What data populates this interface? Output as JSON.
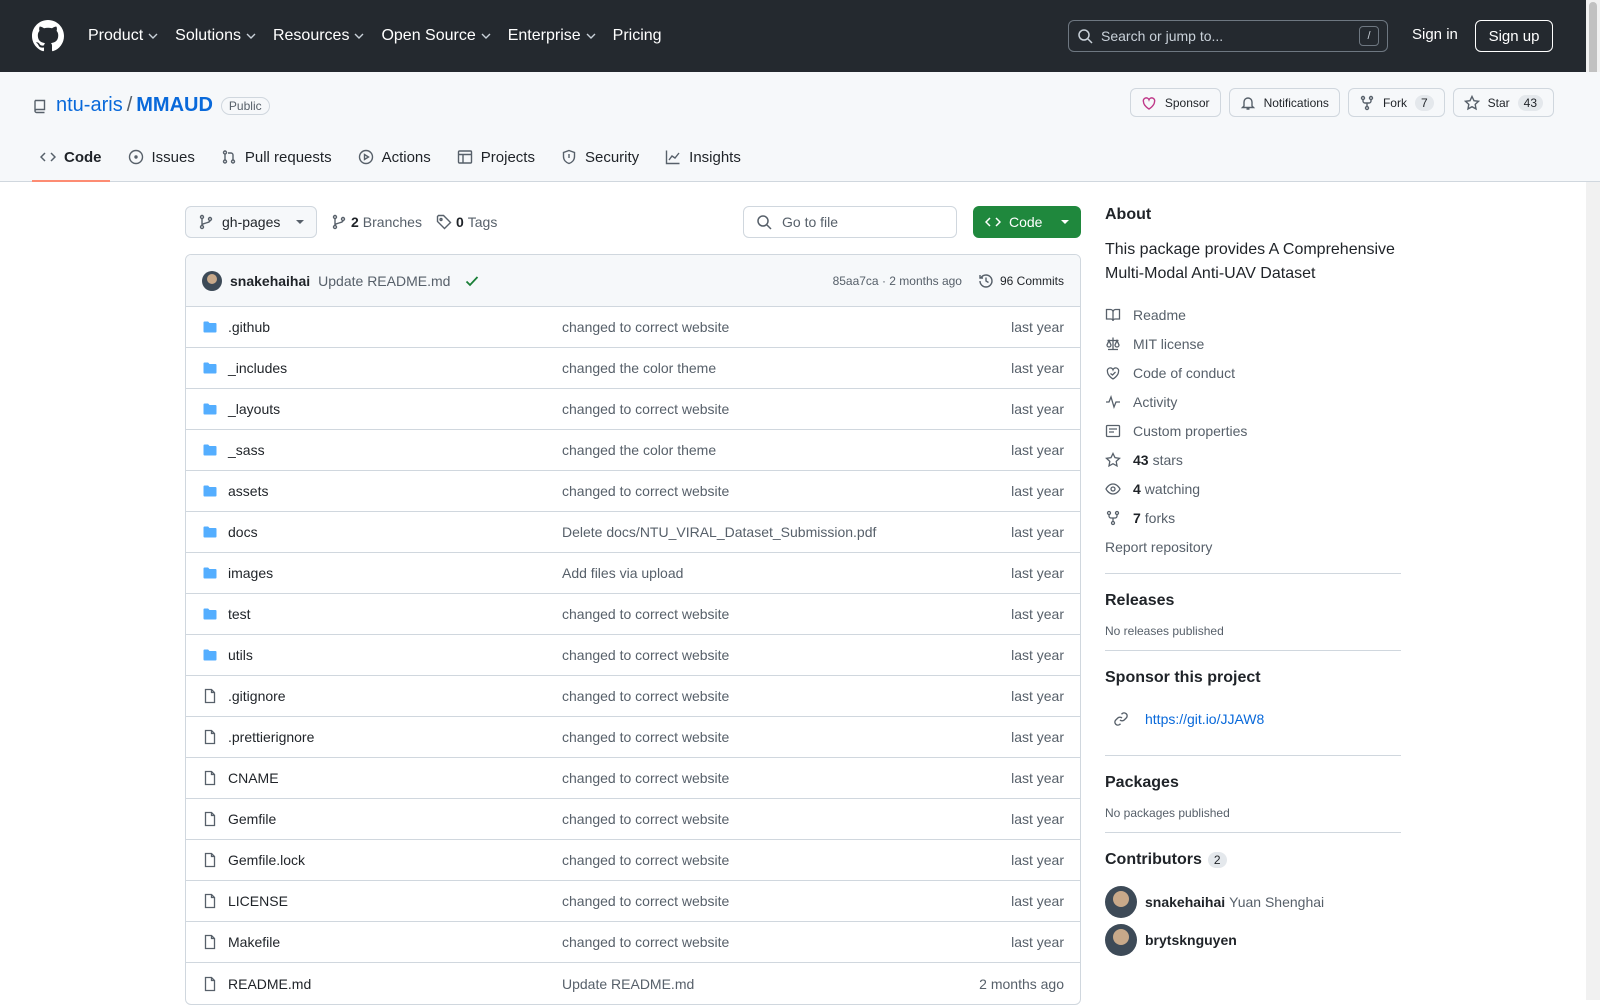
{
  "header": {
    "nav": [
      "Product",
      "Solutions",
      "Resources",
      "Open Source",
      "Enterprise",
      "Pricing"
    ],
    "search_placeholder": "Search or jump to...",
    "search_shortcut": "/",
    "sign_in": "Sign in",
    "sign_up": "Sign up"
  },
  "repo": {
    "owner": "ntu-aris",
    "separator": "/",
    "name": "MMAUD",
    "visibility": "Public",
    "actions": {
      "sponsor": "Sponsor",
      "notifications": "Notifications",
      "fork": "Fork",
      "fork_count": "7",
      "star": "Star",
      "star_count": "43"
    },
    "tabs": [
      {
        "label": "Code",
        "icon": "code-icon",
        "active": true
      },
      {
        "label": "Issues",
        "icon": "issue-icon"
      },
      {
        "label": "Pull requests",
        "icon": "pull-request-icon"
      },
      {
        "label": "Actions",
        "icon": "play-icon"
      },
      {
        "label": "Projects",
        "icon": "table-icon"
      },
      {
        "label": "Security",
        "icon": "shield-icon"
      },
      {
        "label": "Insights",
        "icon": "graph-icon"
      }
    ]
  },
  "toolbar": {
    "branch": "gh-pages",
    "branches_count": "2",
    "branches_label": "Branches",
    "tags_count": "0",
    "tags_label": "Tags",
    "goto_placeholder": "Go to file",
    "code_label": "Code"
  },
  "latest_commit": {
    "author": "snakehaihai",
    "message": "Update README.md",
    "meta": "85aa7ca · 2 months ago",
    "commits": "96 Commits"
  },
  "files": [
    {
      "name": ".github",
      "type": "folder",
      "commit": "changed to correct website",
      "time": "last year"
    },
    {
      "name": "_includes",
      "type": "folder",
      "commit": "changed the color theme",
      "time": "last year"
    },
    {
      "name": "_layouts",
      "type": "folder",
      "commit": "changed to correct website",
      "time": "last year"
    },
    {
      "name": "_sass",
      "type": "folder",
      "commit": "changed the color theme",
      "time": "last year"
    },
    {
      "name": "assets",
      "type": "folder",
      "commit": "changed to correct website",
      "time": "last year"
    },
    {
      "name": "docs",
      "type": "folder",
      "commit": "Delete docs/NTU_VIRAL_Dataset_Submission.pdf",
      "time": "last year"
    },
    {
      "name": "images",
      "type": "folder",
      "commit": "Add files via upload",
      "time": "last year"
    },
    {
      "name": "test",
      "type": "folder",
      "commit": "changed to correct website",
      "time": "last year"
    },
    {
      "name": "utils",
      "type": "folder",
      "commit": "changed to correct website",
      "time": "last year"
    },
    {
      "name": ".gitignore",
      "type": "file",
      "commit": "changed to correct website",
      "time": "last year"
    },
    {
      "name": ".prettierignore",
      "type": "file",
      "commit": "changed to correct website",
      "time": "last year"
    },
    {
      "name": "CNAME",
      "type": "file",
      "commit": "changed to correct website",
      "time": "last year"
    },
    {
      "name": "Gemfile",
      "type": "file",
      "commit": "changed to correct website",
      "time": "last year"
    },
    {
      "name": "Gemfile.lock",
      "type": "file",
      "commit": "changed to correct website",
      "time": "last year"
    },
    {
      "name": "LICENSE",
      "type": "file",
      "commit": "changed to correct website",
      "time": "last year"
    },
    {
      "name": "Makefile",
      "type": "file",
      "commit": "changed to correct website",
      "time": "last year"
    },
    {
      "name": "README.md",
      "type": "file",
      "commit": "Update README.md",
      "time": "2 months ago"
    }
  ],
  "sidebar": {
    "about_title": "About",
    "description": "This package provides A Comprehensive Multi-Modal Anti-UAV Dataset",
    "links": [
      {
        "icon": "book-icon",
        "bold": "",
        "label": "Readme"
      },
      {
        "icon": "law-icon",
        "bold": "",
        "label": "MIT license"
      },
      {
        "icon": "code-of-conduct-icon",
        "bold": "",
        "label": "Code of conduct"
      },
      {
        "icon": "pulse-icon",
        "bold": "",
        "label": "Activity"
      },
      {
        "icon": "note-icon",
        "bold": "",
        "label": "Custom properties"
      },
      {
        "icon": "star-icon",
        "bold": "43",
        "label": "stars"
      },
      {
        "icon": "eye-icon",
        "bold": "4",
        "label": "watching"
      },
      {
        "icon": "fork-icon",
        "bold": "7",
        "label": "forks"
      }
    ],
    "report": "Report repository",
    "releases_title": "Releases",
    "releases_sub": "No releases published",
    "sponsor_title": "Sponsor this project",
    "sponsor_link": "https://git.io/JJAW8",
    "packages_title": "Packages",
    "packages_sub": "No packages published",
    "contributors_title": "Contributors",
    "contributors_count": "2",
    "contributors": [
      {
        "login": "snakehaihai",
        "name": "Yuan Shenghai"
      },
      {
        "login": "brytsknguyen",
        "name": ""
      }
    ]
  },
  "colors": {
    "header_bg": "#24292f",
    "link": "#0969da",
    "code_button": "#1f883d",
    "folder": "#54aeff",
    "active_tab_underline": "#fd8c73"
  }
}
